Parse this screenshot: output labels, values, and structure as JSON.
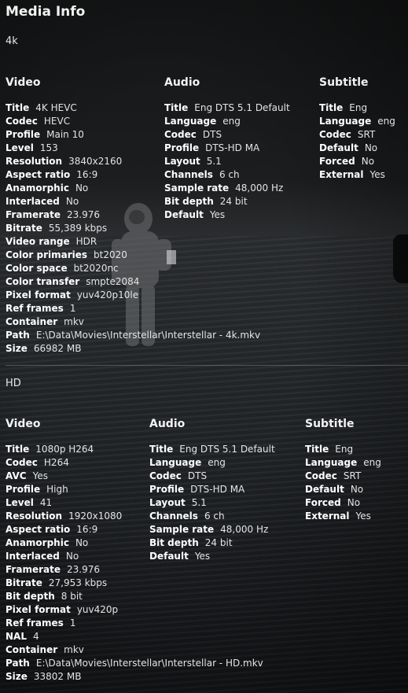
{
  "title": "Media Info",
  "versions": [
    {
      "name": "4k",
      "video": {
        "heading": "Video",
        "rows": [
          {
            "k": "Title",
            "v": "4K HEVC"
          },
          {
            "k": "Codec",
            "v": "HEVC"
          },
          {
            "k": "Profile",
            "v": "Main 10"
          },
          {
            "k": "Level",
            "v": "153"
          },
          {
            "k": "Resolution",
            "v": "3840x2160"
          },
          {
            "k": "Aspect ratio",
            "v": "16:9"
          },
          {
            "k": "Anamorphic",
            "v": "No"
          },
          {
            "k": "Interlaced",
            "v": "No"
          },
          {
            "k": "Framerate",
            "v": "23.976"
          },
          {
            "k": "Bitrate",
            "v": "55,389 kbps"
          },
          {
            "k": "Video range",
            "v": "HDR"
          },
          {
            "k": "Color primaries",
            "v": "bt2020"
          },
          {
            "k": "Color space",
            "v": "bt2020nc"
          },
          {
            "k": "Color transfer",
            "v": "smpte2084"
          },
          {
            "k": "Pixel format",
            "v": "yuv420p10le"
          },
          {
            "k": "Ref frames",
            "v": "1"
          },
          {
            "k": "Container",
            "v": "mkv"
          },
          {
            "k": "Path",
            "v": "E:\\Data\\Movies\\Interstellar\\Interstellar - 4k.mkv"
          },
          {
            "k": "Size",
            "v": "66982 MB"
          }
        ]
      },
      "audio": {
        "heading": "Audio",
        "rows": [
          {
            "k": "Title",
            "v": "Eng DTS 5.1 Default"
          },
          {
            "k": "Language",
            "v": "eng"
          },
          {
            "k": "Codec",
            "v": "DTS"
          },
          {
            "k": "Profile",
            "v": "DTS-HD MA"
          },
          {
            "k": "Layout",
            "v": "5.1"
          },
          {
            "k": "Channels",
            "v": "6 ch"
          },
          {
            "k": "Sample rate",
            "v": "48,000 Hz"
          },
          {
            "k": "Bit depth",
            "v": "24 bit"
          },
          {
            "k": "Default",
            "v": "Yes"
          }
        ]
      },
      "subtitle": {
        "heading": "Subtitle",
        "rows": [
          {
            "k": "Title",
            "v": "Eng"
          },
          {
            "k": "Language",
            "v": "eng"
          },
          {
            "k": "Codec",
            "v": "SRT"
          },
          {
            "k": "Default",
            "v": "No"
          },
          {
            "k": "Forced",
            "v": "No"
          },
          {
            "k": "External",
            "v": "Yes"
          }
        ]
      }
    },
    {
      "name": "HD",
      "video": {
        "heading": "Video",
        "rows": [
          {
            "k": "Title",
            "v": "1080p H264"
          },
          {
            "k": "Codec",
            "v": "H264"
          },
          {
            "k": "AVC",
            "v": "Yes"
          },
          {
            "k": "Profile",
            "v": "High"
          },
          {
            "k": "Level",
            "v": "41"
          },
          {
            "k": "Resolution",
            "v": "1920x1080"
          },
          {
            "k": "Aspect ratio",
            "v": "16:9"
          },
          {
            "k": "Anamorphic",
            "v": "No"
          },
          {
            "k": "Interlaced",
            "v": "No"
          },
          {
            "k": "Framerate",
            "v": "23.976"
          },
          {
            "k": "Bitrate",
            "v": "27,953 kbps"
          },
          {
            "k": "Bit depth",
            "v": "8 bit"
          },
          {
            "k": "Pixel format",
            "v": "yuv420p"
          },
          {
            "k": "Ref frames",
            "v": "1"
          },
          {
            "k": "NAL",
            "v": "4"
          },
          {
            "k": "Container",
            "v": "mkv"
          },
          {
            "k": "Path",
            "v": "E:\\Data\\Movies\\Interstellar\\Interstellar - HD.mkv"
          },
          {
            "k": "Size",
            "v": "33802 MB"
          }
        ]
      },
      "audio": {
        "heading": "Audio",
        "rows": [
          {
            "k": "Title",
            "v": "Eng DTS 5.1 Default"
          },
          {
            "k": "Language",
            "v": "eng"
          },
          {
            "k": "Codec",
            "v": "DTS"
          },
          {
            "k": "Profile",
            "v": "DTS-HD MA"
          },
          {
            "k": "Layout",
            "v": "5.1"
          },
          {
            "k": "Channels",
            "v": "6 ch"
          },
          {
            "k": "Sample rate",
            "v": "48,000 Hz"
          },
          {
            "k": "Bit depth",
            "v": "24 bit"
          },
          {
            "k": "Default",
            "v": "Yes"
          }
        ]
      },
      "subtitle": {
        "heading": "Subtitle",
        "rows": [
          {
            "k": "Title",
            "v": "Eng"
          },
          {
            "k": "Language",
            "v": "eng"
          },
          {
            "k": "Codec",
            "v": "SRT"
          },
          {
            "k": "Default",
            "v": "No"
          },
          {
            "k": "Forced",
            "v": "No"
          },
          {
            "k": "External",
            "v": "Yes"
          }
        ]
      }
    }
  ]
}
